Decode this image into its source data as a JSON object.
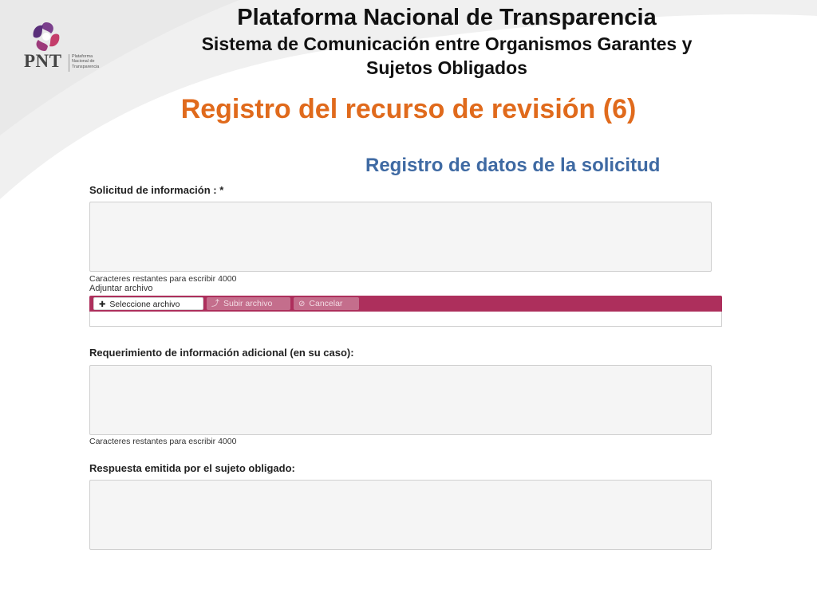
{
  "logo": {
    "text": "PNT",
    "lines": [
      "Plataforma",
      "Nacional de",
      "Transparencia"
    ]
  },
  "header": {
    "title": "Plataforma Nacional de Transparencia",
    "subtitle_line1": "Sistema de Comunicación entre Organismos Garantes y",
    "subtitle_line2": "Sujetos Obligados"
  },
  "section_title": "Registro del recurso de revisión (6)",
  "sub_section": "Registro de datos de la solicitud",
  "form": {
    "solicitud": {
      "label": "Solicitud de información : *",
      "value": "",
      "counter": "Caracteres restantes para escribir 4000"
    },
    "adjuntar": {
      "label": "Adjuntar archivo",
      "select_button": "Seleccione archivo",
      "upload_button": "Subir archivo",
      "cancel_button": "Cancelar",
      "icons": {
        "select": "plus-icon",
        "upload": "upload-icon",
        "cancel": "ban-icon"
      }
    },
    "requerimiento": {
      "label": "Requerimiento de información adicional (en su caso):",
      "value": "",
      "counter": "Caracteres restantes para escribir 4000"
    },
    "respuesta": {
      "label": "Respuesta emitida por el sujeto obligado:",
      "value": ""
    }
  },
  "colors": {
    "section_title": "#e06a1c",
    "sub_section": "#3f6aa3",
    "upload_bar": "#ad2f5c"
  }
}
